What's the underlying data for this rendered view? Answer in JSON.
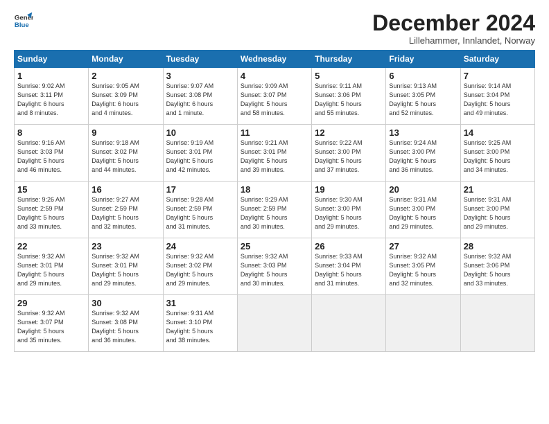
{
  "header": {
    "logo_line1": "General",
    "logo_line2": "Blue",
    "month_title": "December 2024",
    "location": "Lillehammer, Innlandet, Norway"
  },
  "weekdays": [
    "Sunday",
    "Monday",
    "Tuesday",
    "Wednesday",
    "Thursday",
    "Friday",
    "Saturday"
  ],
  "weeks": [
    [
      {
        "day": "1",
        "info": "Sunrise: 9:02 AM\nSunset: 3:11 PM\nDaylight: 6 hours\nand 8 minutes."
      },
      {
        "day": "2",
        "info": "Sunrise: 9:05 AM\nSunset: 3:09 PM\nDaylight: 6 hours\nand 4 minutes."
      },
      {
        "day": "3",
        "info": "Sunrise: 9:07 AM\nSunset: 3:08 PM\nDaylight: 6 hours\nand 1 minute."
      },
      {
        "day": "4",
        "info": "Sunrise: 9:09 AM\nSunset: 3:07 PM\nDaylight: 5 hours\nand 58 minutes."
      },
      {
        "day": "5",
        "info": "Sunrise: 9:11 AM\nSunset: 3:06 PM\nDaylight: 5 hours\nand 55 minutes."
      },
      {
        "day": "6",
        "info": "Sunrise: 9:13 AM\nSunset: 3:05 PM\nDaylight: 5 hours\nand 52 minutes."
      },
      {
        "day": "7",
        "info": "Sunrise: 9:14 AM\nSunset: 3:04 PM\nDaylight: 5 hours\nand 49 minutes."
      }
    ],
    [
      {
        "day": "8",
        "info": "Sunrise: 9:16 AM\nSunset: 3:03 PM\nDaylight: 5 hours\nand 46 minutes."
      },
      {
        "day": "9",
        "info": "Sunrise: 9:18 AM\nSunset: 3:02 PM\nDaylight: 5 hours\nand 44 minutes."
      },
      {
        "day": "10",
        "info": "Sunrise: 9:19 AM\nSunset: 3:01 PM\nDaylight: 5 hours\nand 42 minutes."
      },
      {
        "day": "11",
        "info": "Sunrise: 9:21 AM\nSunset: 3:01 PM\nDaylight: 5 hours\nand 39 minutes."
      },
      {
        "day": "12",
        "info": "Sunrise: 9:22 AM\nSunset: 3:00 PM\nDaylight: 5 hours\nand 37 minutes."
      },
      {
        "day": "13",
        "info": "Sunrise: 9:24 AM\nSunset: 3:00 PM\nDaylight: 5 hours\nand 36 minutes."
      },
      {
        "day": "14",
        "info": "Sunrise: 9:25 AM\nSunset: 3:00 PM\nDaylight: 5 hours\nand 34 minutes."
      }
    ],
    [
      {
        "day": "15",
        "info": "Sunrise: 9:26 AM\nSunset: 2:59 PM\nDaylight: 5 hours\nand 33 minutes."
      },
      {
        "day": "16",
        "info": "Sunrise: 9:27 AM\nSunset: 2:59 PM\nDaylight: 5 hours\nand 32 minutes."
      },
      {
        "day": "17",
        "info": "Sunrise: 9:28 AM\nSunset: 2:59 PM\nDaylight: 5 hours\nand 31 minutes."
      },
      {
        "day": "18",
        "info": "Sunrise: 9:29 AM\nSunset: 2:59 PM\nDaylight: 5 hours\nand 30 minutes."
      },
      {
        "day": "19",
        "info": "Sunrise: 9:30 AM\nSunset: 3:00 PM\nDaylight: 5 hours\nand 29 minutes."
      },
      {
        "day": "20",
        "info": "Sunrise: 9:31 AM\nSunset: 3:00 PM\nDaylight: 5 hours\nand 29 minutes."
      },
      {
        "day": "21",
        "info": "Sunrise: 9:31 AM\nSunset: 3:00 PM\nDaylight: 5 hours\nand 29 minutes."
      }
    ],
    [
      {
        "day": "22",
        "info": "Sunrise: 9:32 AM\nSunset: 3:01 PM\nDaylight: 5 hours\nand 29 minutes."
      },
      {
        "day": "23",
        "info": "Sunrise: 9:32 AM\nSunset: 3:01 PM\nDaylight: 5 hours\nand 29 minutes."
      },
      {
        "day": "24",
        "info": "Sunrise: 9:32 AM\nSunset: 3:02 PM\nDaylight: 5 hours\nand 29 minutes."
      },
      {
        "day": "25",
        "info": "Sunrise: 9:32 AM\nSunset: 3:03 PM\nDaylight: 5 hours\nand 30 minutes."
      },
      {
        "day": "26",
        "info": "Sunrise: 9:33 AM\nSunset: 3:04 PM\nDaylight: 5 hours\nand 31 minutes."
      },
      {
        "day": "27",
        "info": "Sunrise: 9:32 AM\nSunset: 3:05 PM\nDaylight: 5 hours\nand 32 minutes."
      },
      {
        "day": "28",
        "info": "Sunrise: 9:32 AM\nSunset: 3:06 PM\nDaylight: 5 hours\nand 33 minutes."
      }
    ],
    [
      {
        "day": "29",
        "info": "Sunrise: 9:32 AM\nSunset: 3:07 PM\nDaylight: 5 hours\nand 35 minutes."
      },
      {
        "day": "30",
        "info": "Sunrise: 9:32 AM\nSunset: 3:08 PM\nDaylight: 5 hours\nand 36 minutes."
      },
      {
        "day": "31",
        "info": "Sunrise: 9:31 AM\nSunset: 3:10 PM\nDaylight: 5 hours\nand 38 minutes."
      },
      {
        "day": "",
        "info": ""
      },
      {
        "day": "",
        "info": ""
      },
      {
        "day": "",
        "info": ""
      },
      {
        "day": "",
        "info": ""
      }
    ]
  ]
}
